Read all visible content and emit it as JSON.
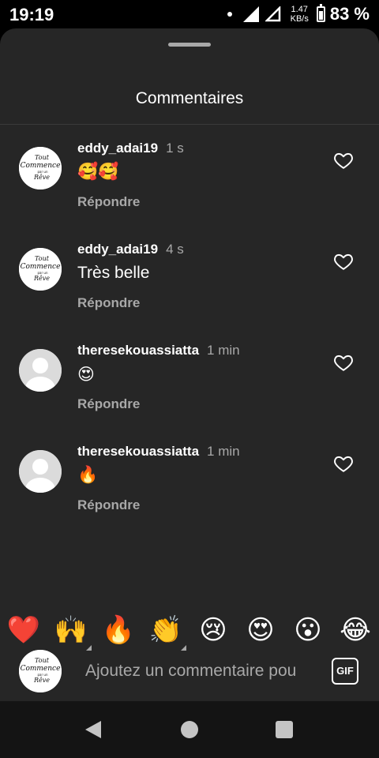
{
  "status_bar": {
    "time": "19:19",
    "net_speed_value": "1.47",
    "net_speed_unit": "KB/s",
    "battery": "83 %"
  },
  "sheet": {
    "title": "Commentaires"
  },
  "comments": [
    {
      "username": "eddy_adai19",
      "time": "1 s",
      "text": "🥰🥰",
      "reply": "Répondre",
      "avatar": "brand-logo"
    },
    {
      "username": "eddy_adai19",
      "time": "4 s",
      "text": "Très belle",
      "reply": "Répondre",
      "avatar": "brand-logo"
    },
    {
      "username": "theresekouassiatta",
      "time": "1 min",
      "text": "😍",
      "reply": "Répondre",
      "avatar": "default-user"
    },
    {
      "username": "theresekouassiatta",
      "time": "1 min",
      "text": "🔥",
      "reply": "Répondre",
      "avatar": "default-user"
    }
  ],
  "logo": {
    "line1": "Tout",
    "line2": "Commence",
    "line3": "par un",
    "line4": "Rêve"
  },
  "emoji_bar": [
    "❤️",
    "🙌",
    "🔥",
    "👏",
    "😢",
    "😍",
    "😮",
    "😂"
  ],
  "input": {
    "placeholder": "Ajoutez un commentaire pou",
    "gif_label": "GIF"
  },
  "colors": {
    "sheet_bg": "#262626",
    "muted_text": "#a8a8a8",
    "nav_bg": "#141414"
  }
}
